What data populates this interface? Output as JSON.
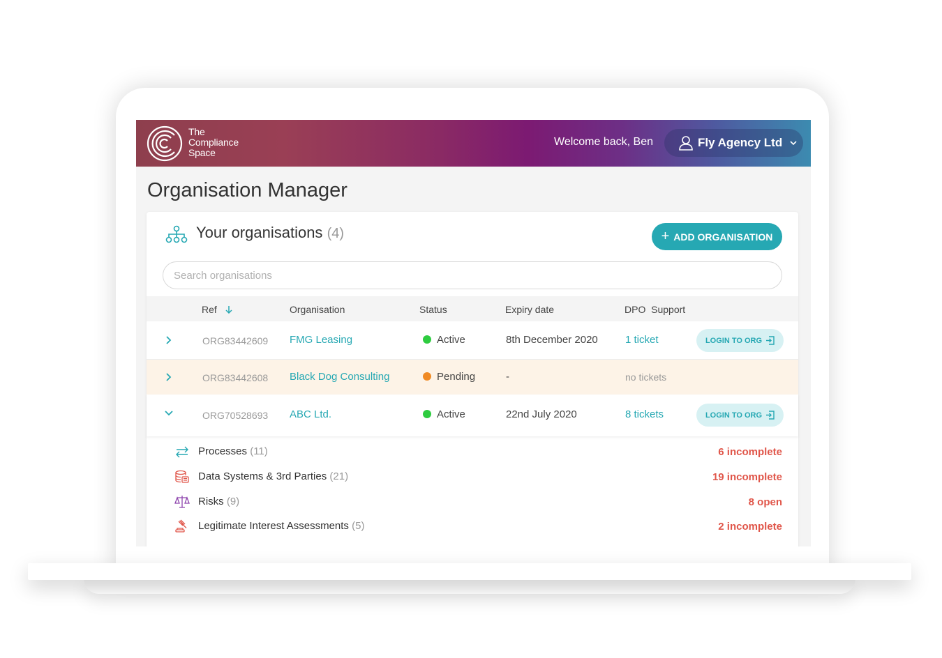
{
  "header": {
    "brand_line1": "The",
    "brand_line2": "Compliance",
    "brand_line3": "Space",
    "welcome": "Welcome back, Ben",
    "account": "Fly Agency Ltd"
  },
  "page": {
    "title": "Organisation Manager"
  },
  "card": {
    "title": "Your organisations",
    "count": "(4)",
    "add_button": "ADD ORGANISATION",
    "search_placeholder": "Search organisations"
  },
  "table": {
    "columns": [
      "Ref",
      "Organisation",
      "Status",
      "Expiry date",
      "DPO  Support"
    ],
    "rows": [
      {
        "ref": "ORG83442609",
        "organisation": "FMG Leasing",
        "status": "Active",
        "expiry": "8th December 2020",
        "support": "1 ticket",
        "login": "LOGIN TO ORG"
      },
      {
        "ref": "ORG83442608",
        "organisation": "Black Dog Consulting",
        "status": "Pending",
        "expiry": "-",
        "support": "no tickets"
      },
      {
        "ref": "ORG70528693",
        "organisation": "ABC Ltd.",
        "status": "Active",
        "expiry": "22nd July 2020",
        "support": "8 tickets",
        "login": "LOGIN TO ORG"
      }
    ]
  },
  "details": [
    {
      "label": "Processes",
      "count": "(11)",
      "status": "6 incomplete",
      "icon": "arrows-icon"
    },
    {
      "label": "Data Systems & 3rd Parties",
      "count": "(21)",
      "status": "19 incomplete",
      "icon": "database-icon"
    },
    {
      "label": "Risks",
      "count": "(9)",
      "status": "8 open",
      "icon": "scales-icon"
    },
    {
      "label": "Legitimate Interest Assessments",
      "count": "(5)",
      "status": "2 incomplete",
      "icon": "gavel-icon"
    }
  ],
  "colors": {
    "accent": "#26a8b3",
    "active": "#2ecc40",
    "pending": "#f08a24",
    "warning": "#e0564a"
  }
}
